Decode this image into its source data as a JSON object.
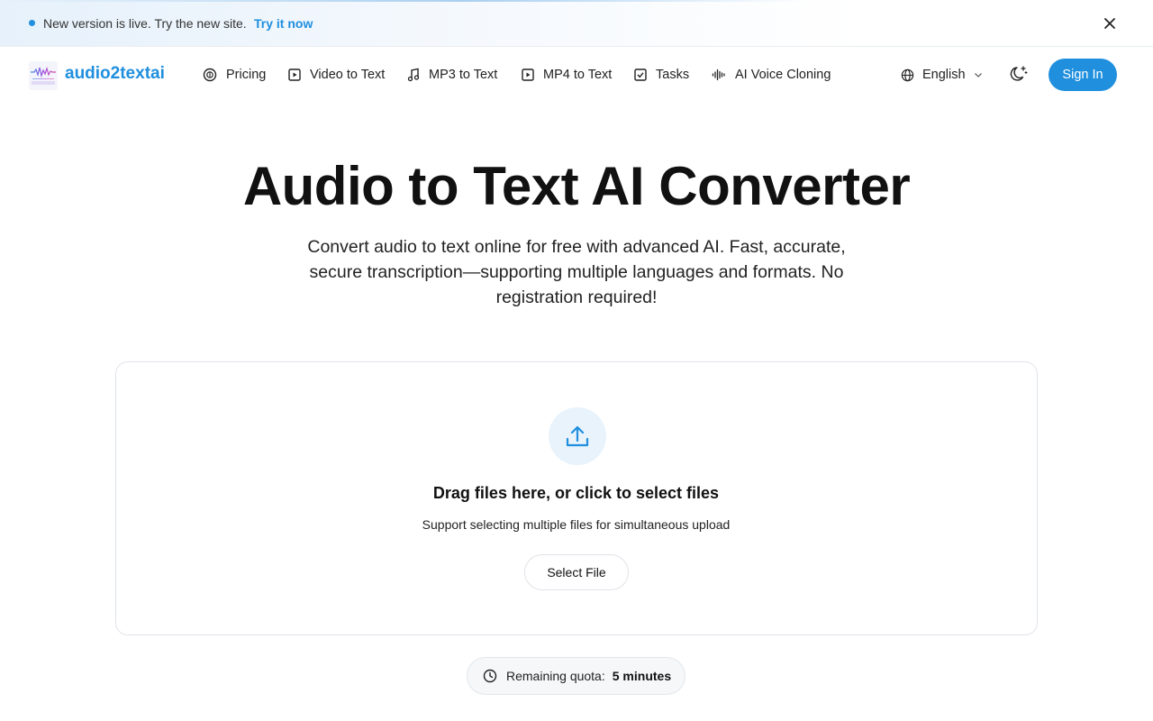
{
  "banner": {
    "message": "New version is live. Try the new site.",
    "link_label": "Try it now",
    "dot_color": "#1f8fde"
  },
  "header": {
    "logo_text": "audio2textai",
    "nav": [
      {
        "label": "Pricing",
        "icon": "dollar-circle-icon"
      },
      {
        "label": "Video to Text",
        "icon": "play-square-icon"
      },
      {
        "label": "MP3 to Text",
        "icon": "music-note-icon"
      },
      {
        "label": "MP4 to Text",
        "icon": "play-square-icon"
      },
      {
        "label": "Tasks",
        "icon": "check-square-icon"
      },
      {
        "label": "AI Voice Cloning",
        "icon": "audio-waveform-icon"
      }
    ],
    "language": "English",
    "signin_label": "Sign In",
    "accent_color": "#1f8fde"
  },
  "hero": {
    "title": "Audio to Text AI Converter",
    "subtitle": "Convert audio to text online for free with advanced AI. Fast, accurate, secure transcription—supporting multiple languages and formats. No registration required!"
  },
  "upload": {
    "title": "Drag files here, or click to select files",
    "subtitle": "Support selecting multiple files for simultaneous upload",
    "button_label": "Select File"
  },
  "quota": {
    "label": "Remaining quota:",
    "value": "5 minutes"
  }
}
